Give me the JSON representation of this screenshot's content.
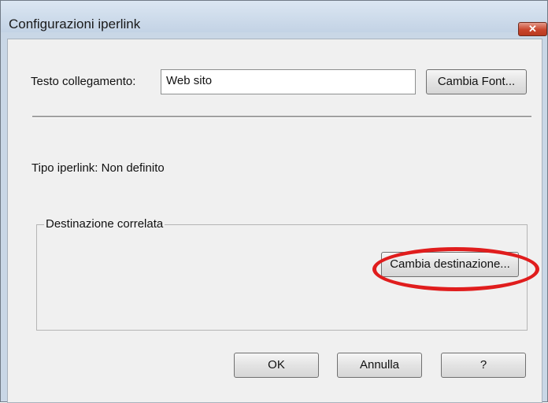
{
  "window": {
    "title": "Configurazioni iperlink",
    "close_icon": "close-icon",
    "accent_color": "#e01d1d"
  },
  "link_text": {
    "label": "Testo collegamento:",
    "value": "Web sito",
    "font_button": "Cambia Font..."
  },
  "hyperlink_type": {
    "text": "Tipo iperlink: Non definito"
  },
  "destination": {
    "group_label": "Destinazione correlata",
    "change_button": "Cambia destinazione..."
  },
  "footer": {
    "ok": "OK",
    "cancel": "Annulla",
    "help": "?"
  }
}
